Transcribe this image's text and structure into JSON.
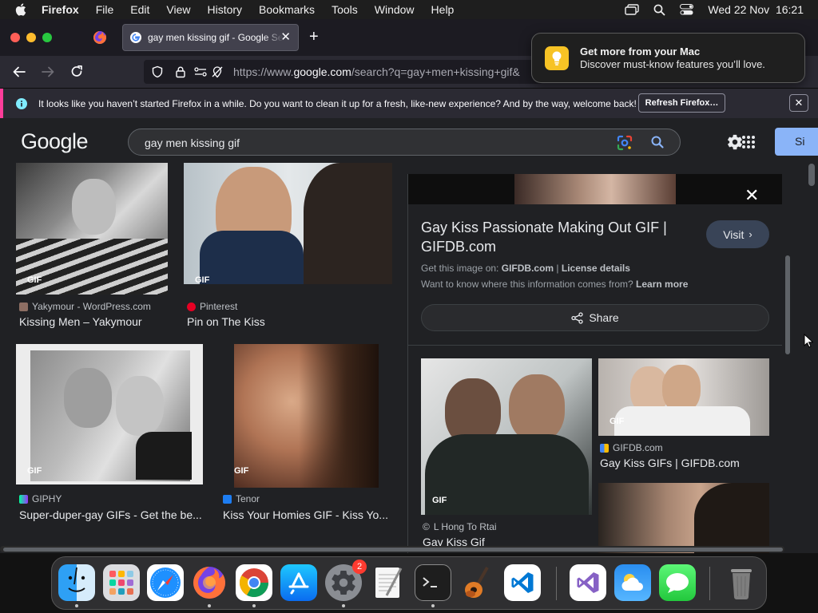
{
  "menubar": {
    "app": "Firefox",
    "items": [
      "File",
      "Edit",
      "View",
      "History",
      "Bookmarks",
      "Tools",
      "Window",
      "Help"
    ],
    "clock": "Wed 22 Nov  16:21"
  },
  "browser": {
    "tab_title": "gay men kissing gif - Google Search",
    "url_prefix": "https://www.",
    "url_domain": "google.com",
    "url_rest": "/search?q=gay+men+kissing+gif&"
  },
  "notification": {
    "title": "Get more from your Mac",
    "body": "Discover must-know features you’ll love."
  },
  "infobar": {
    "message": "It looks like you haven’t started Firefox in a while. Do you want to clean it up for a fresh, like-new experience? And by the way, welcome back!",
    "button": "Refresh Firefox…"
  },
  "google": {
    "logo": "Google",
    "query": "gay men kissing gif",
    "signin_label": "Si"
  },
  "results": [
    {
      "source": "Yakymour - WordPress.com",
      "title": "Kissing Men – Yakymour",
      "badge": "GIF"
    },
    {
      "source": "Pinterest",
      "title": "Pin on The Kiss",
      "badge": "GIF"
    },
    {
      "source": "GIPHY",
      "title": "Super-duper-gay GIFs - Get the be...",
      "badge": "GIF"
    },
    {
      "source": "Tenor",
      "title": "Kiss Your Homies GIF - Kiss Yo...",
      "badge": "GIF"
    }
  ],
  "panel": {
    "title": "Gay Kiss Passionate Making Out GIF | GIFDB.com",
    "visit": "Visit",
    "get_image_label": "Get this image on:",
    "get_image_source": "GIFDB.com",
    "license": "License details",
    "want_know": "Want to know where this information comes from?",
    "learn_more": "Learn more",
    "share": "Share",
    "related": [
      {
        "badge": "GIF",
        "source": "L Hong To Rtai",
        "title": "Gay Kiss Gif"
      },
      {
        "badge": "GIF",
        "source": "GIFDB.com",
        "title": "Gay Kiss GIFs | GIFDB.com"
      }
    ]
  },
  "dock": {
    "settings_badge": "2"
  },
  "colors": {
    "page_bg": "#202124",
    "search_bg": "#303134",
    "accent_blue": "#8ab4f8",
    "infobar_accent": "#ff3d9a",
    "notif_icon": "#f7c325"
  }
}
